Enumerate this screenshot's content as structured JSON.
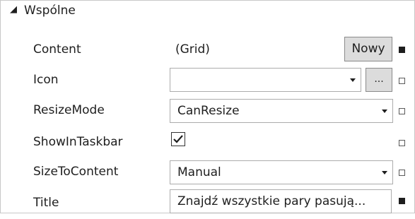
{
  "section": {
    "title": "Wspólne",
    "expanded_glyph": "◢"
  },
  "properties": [
    {
      "key": "content",
      "label": "Content",
      "value": "(Grid)",
      "button": "Nowy",
      "marker": "filled"
    },
    {
      "key": "icon",
      "label": "Icon",
      "value": "",
      "button": "...",
      "marker": "empty",
      "control": "dropdown"
    },
    {
      "key": "resizemode",
      "label": "ResizeMode",
      "value": "CanResize",
      "marker": "empty",
      "control": "dropdown"
    },
    {
      "key": "showintaskbar",
      "label": "ShowInTaskbar",
      "checked": true,
      "marker": "empty",
      "control": "checkbox"
    },
    {
      "key": "sizetocontent",
      "label": "SizeToContent",
      "value": "Manual",
      "marker": "empty",
      "control": "dropdown"
    },
    {
      "key": "title",
      "label": "Title",
      "value": "Znajdź wszystkie pary pasują...",
      "marker": "filled",
      "control": "textbox"
    }
  ],
  "icons": {
    "expander": "triangle-expanded-icon",
    "dropdown": "chevron-down-icon",
    "checkmark": "checkmark-icon",
    "marker_filled": "property-set-marker-icon",
    "marker_empty": "property-default-marker-icon"
  },
  "colors": {
    "button_bg": "#dcdcdc",
    "border": "#acacac",
    "text": "#1e1e1e"
  }
}
